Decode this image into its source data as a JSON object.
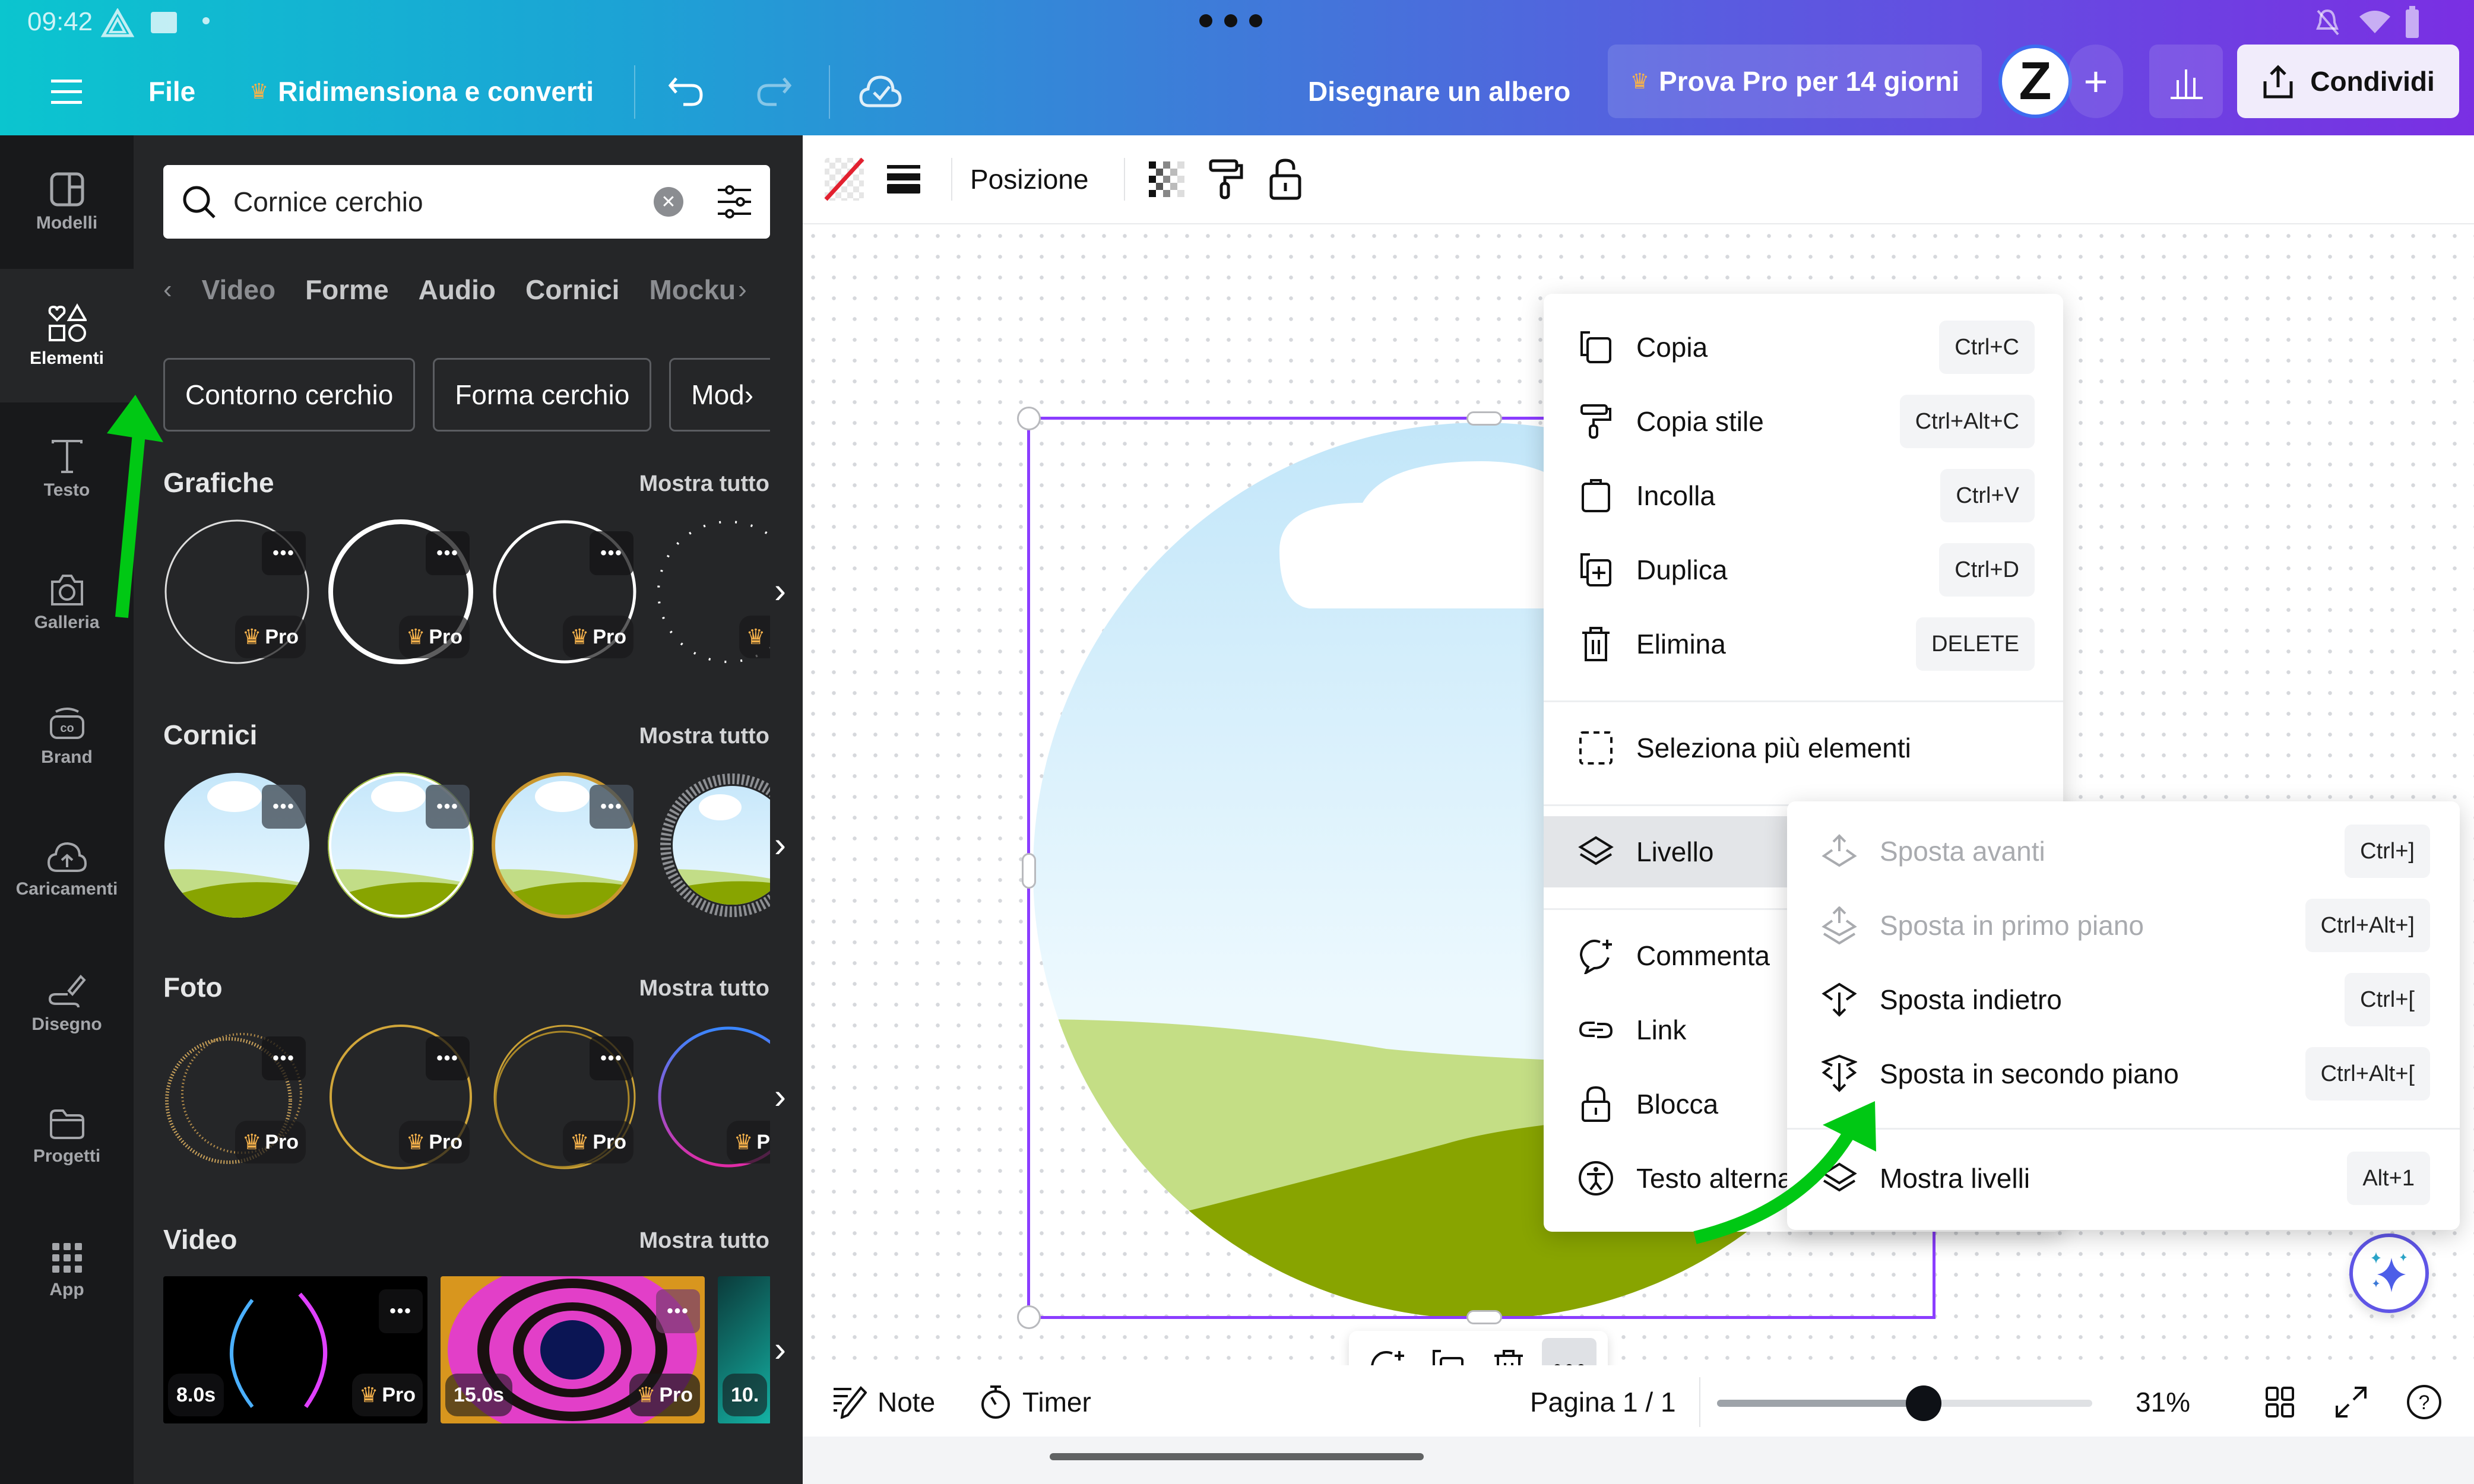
{
  "status_bar": {
    "time": "09:42"
  },
  "header": {
    "menu_icon": "hamburger-icon",
    "file_label": "File",
    "resize_label": "Ridimensiona e converti",
    "doc_title": "Disegnare un albero",
    "try_pro_label": "Prova Pro per 14 giorni",
    "avatar_letter": "Z",
    "share_label": "Condividi"
  },
  "nav": {
    "items": [
      {
        "label": "Modelli",
        "icon": "template-icon"
      },
      {
        "label": "Elementi",
        "icon": "elements-icon",
        "active": true
      },
      {
        "label": "Testo",
        "icon": "text-icon"
      },
      {
        "label": "Galleria",
        "icon": "camera-icon"
      },
      {
        "label": "Brand",
        "icon": "brand-icon"
      },
      {
        "label": "Caricamenti",
        "icon": "cloud-upload-icon"
      },
      {
        "label": "Disegno",
        "icon": "draw-icon"
      },
      {
        "label": "Progetti",
        "icon": "folder-icon"
      },
      {
        "label": "App",
        "icon": "apps-grid-icon"
      }
    ]
  },
  "panel": {
    "search": {
      "value": "Cornice cerchio",
      "placeholder": ""
    },
    "categories": [
      "Video",
      "Forme",
      "Audio",
      "Cornici",
      "Mocku"
    ],
    "chips": [
      "Contorno cerchio",
      "Forma cerchio",
      "Mod"
    ],
    "sections": [
      {
        "title": "Grafiche",
        "more": "Mostra tutto",
        "badges": [
          "Pro",
          "Pro",
          "Pro",
          "Pr"
        ]
      },
      {
        "title": "Cornici",
        "more": "Mostra tutto"
      },
      {
        "title": "Foto",
        "more": "Mostra tutto",
        "badges": [
          "Pro",
          "Pro",
          "Pro",
          "Pro"
        ]
      },
      {
        "title": "Video",
        "more": "Mostra tutto",
        "durations": [
          "8.0s",
          "15.0s",
          "10."
        ],
        "badges": [
          "Pro",
          "Pro"
        ]
      }
    ]
  },
  "editor_toolbar": {
    "position_label": "Posizione"
  },
  "context_menu": {
    "items": [
      {
        "label": "Copia",
        "shortcut": "Ctrl+C"
      },
      {
        "label": "Copia stile",
        "shortcut": "Ctrl+Alt+C"
      },
      {
        "label": "Incolla",
        "shortcut": "Ctrl+V"
      },
      {
        "label": "Duplica",
        "shortcut": "Ctrl+D"
      },
      {
        "label": "Elimina",
        "shortcut": "DELETE"
      },
      {
        "label": "Seleziona più elementi"
      },
      {
        "label": "Livello"
      },
      {
        "label": "Commenta"
      },
      {
        "label": "Link"
      },
      {
        "label": "Blocca"
      },
      {
        "label": "Testo alternativo"
      }
    ]
  },
  "layer_submenu": {
    "items": [
      {
        "label": "Sposta avanti",
        "shortcut": "Ctrl+]",
        "disabled": true
      },
      {
        "label": "Sposta in primo piano",
        "shortcut": "Ctrl+Alt+]",
        "disabled": true
      },
      {
        "label": "Sposta indietro",
        "shortcut": "Ctrl+["
      },
      {
        "label": "Sposta in secondo piano",
        "shortcut": "Ctrl+Alt+["
      },
      {
        "label": "Mostra livelli",
        "shortcut": "Alt+1"
      }
    ]
  },
  "bottom_bar": {
    "notes_label": "Note",
    "timer_label": "Timer",
    "page_label": "Pagina 1 / 1",
    "zoom_percent": "31%",
    "zoom_value": 31,
    "zoom_slider_fraction": 0.55
  },
  "colors": {
    "accent_purple": "#8b3dff",
    "annotation_arrow": "#00c814",
    "pro_crown": "#f5b14b"
  }
}
